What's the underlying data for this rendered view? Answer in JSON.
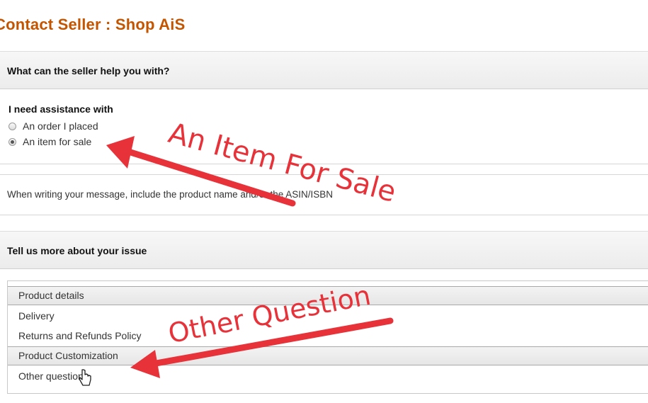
{
  "page": {
    "title": "Contact Seller : Shop AiS"
  },
  "help_section": {
    "header": "What can the seller help you with?",
    "assist_label": "I need assistance with",
    "options": [
      {
        "label": "An order I placed",
        "selected": false
      },
      {
        "label": "An item for sale",
        "selected": true
      }
    ]
  },
  "hint": {
    "text": "When writing your message, include the product name and/or the ASIN/ISBN"
  },
  "issue_section": {
    "header": "Tell us more about your issue",
    "items": [
      {
        "label": "Product details",
        "highlighted": true
      },
      {
        "label": "Delivery",
        "highlighted": false
      },
      {
        "label": "Returns and Refunds Policy",
        "highlighted": false
      },
      {
        "label": "Product Customization",
        "highlighted": true
      },
      {
        "label": "Other question",
        "highlighted": false
      }
    ]
  },
  "annotations": {
    "item_for_sale": "An Item For Sale",
    "other_question": "Other Question",
    "color": "#e8323a"
  },
  "colors": {
    "title": "#c45500"
  }
}
